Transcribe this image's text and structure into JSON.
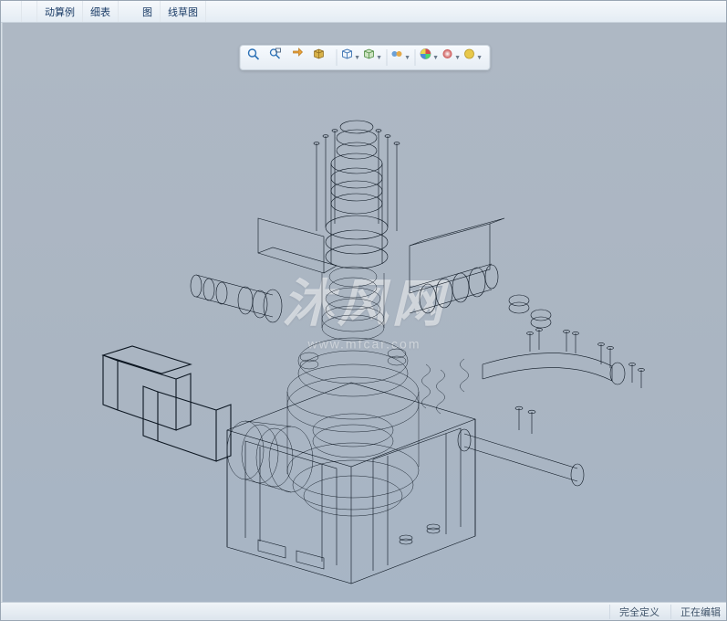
{
  "ribbon": {
    "items": [
      {
        "label": "",
        "sub": ""
      },
      {
        "label": "",
        "sub": ""
      },
      {
        "label": "动算例",
        "sub": ""
      },
      {
        "label": "细表",
        "sub": ""
      },
      {
        "label": "图",
        "sub": ""
      },
      {
        "label": "线草图",
        "sub": ""
      }
    ]
  },
  "view_toolbar": {
    "icons": [
      "zoom-fit-icon",
      "zoom-area-icon",
      "zoom-prev-icon",
      "section-icon",
      "view-orient-icon",
      "display-style-icon",
      "hide-show-icon",
      "edit-appearance-icon",
      "apply-scene-icon",
      "view-settings-icon"
    ]
  },
  "watermark": {
    "main": "沐风网",
    "sub": "www.mfcar.com"
  },
  "status": {
    "left": "完全定义",
    "right": "正在编辑"
  }
}
